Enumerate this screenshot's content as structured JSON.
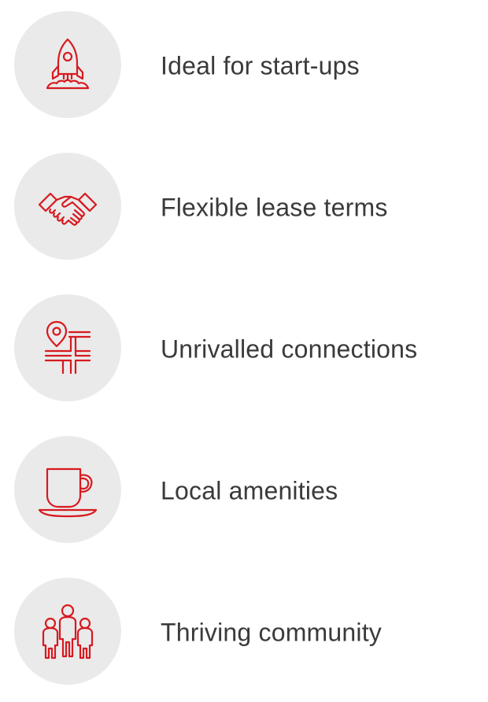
{
  "accent_color": "#d7191f",
  "features": [
    {
      "icon": "rocket-icon",
      "label": "Ideal for start-ups"
    },
    {
      "icon": "handshake-icon",
      "label": "Flexible lease terms"
    },
    {
      "icon": "map-pin-roads-icon",
      "label": "Unrivalled connections"
    },
    {
      "icon": "coffee-cup-icon",
      "label": "Local amenities"
    },
    {
      "icon": "people-group-icon",
      "label": "Thriving community"
    }
  ]
}
